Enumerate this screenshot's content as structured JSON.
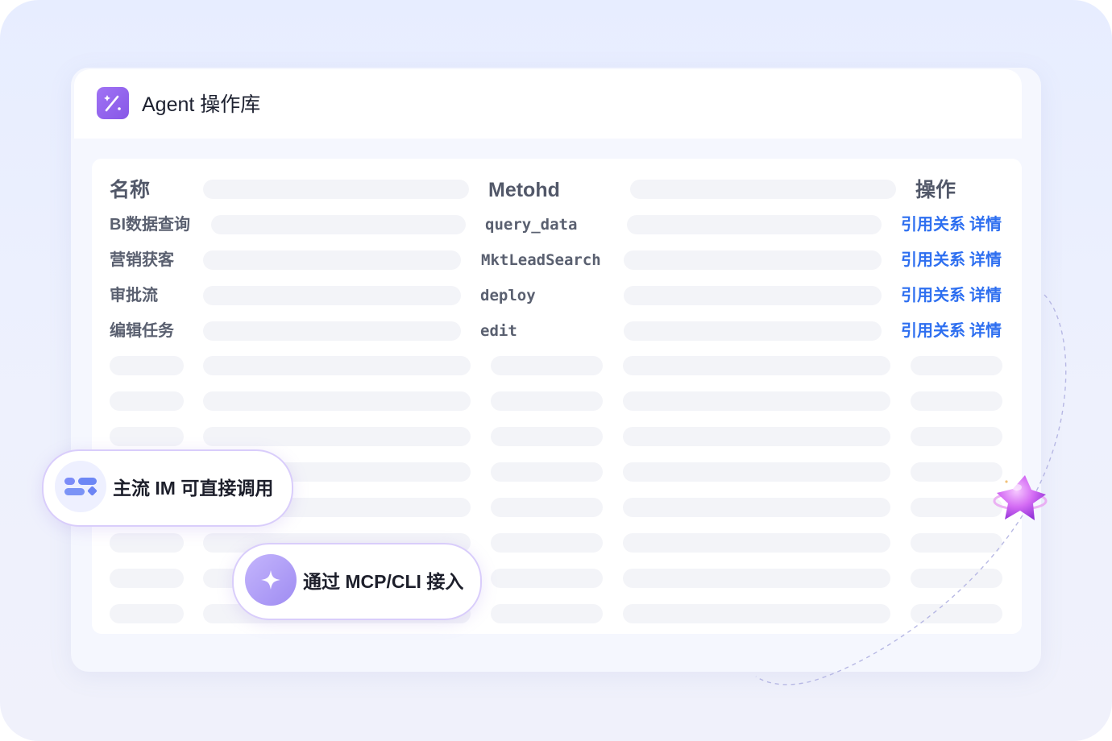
{
  "app": {
    "title": "Agent 操作库",
    "icon": "magic-wand-icon",
    "accent_color": "#8b5cf6"
  },
  "table": {
    "headers": {
      "name": "名称",
      "method": "Metohd",
      "actions": "操作"
    },
    "rows": [
      {
        "name": "BI数据查询",
        "method": "query_data",
        "ref_link": "引用关系",
        "detail_link": "详情"
      },
      {
        "name": "营销获客",
        "method": "MktLeadSearch",
        "ref_link": "引用关系",
        "detail_link": "详情"
      },
      {
        "name": "审批流",
        "method": "deploy",
        "ref_link": "引用关系",
        "detail_link": "详情"
      },
      {
        "name": "编辑任务",
        "method": "edit",
        "ref_link": "引用关系",
        "detail_link": "详情"
      }
    ],
    "link_color": "#2e6ff0"
  },
  "badges": {
    "im": {
      "label": "主流 IM 可直接调用",
      "icon": "apps-grid-icon"
    },
    "mcp": {
      "label": "通过 MCP/CLI 接入",
      "icon": "sparkle-icon"
    }
  },
  "decoration": {
    "icon": "star-planet-icon"
  }
}
